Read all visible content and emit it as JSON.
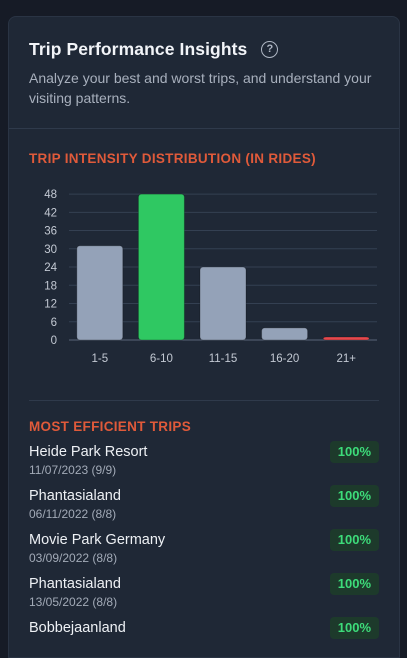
{
  "header": {
    "title": "Trip Performance Insights",
    "help_icon": "question-circle-icon",
    "subtitle": "Analyze your best and worst trips, and understand your visiting patterns."
  },
  "distribution": {
    "heading": "TRIP INTENSITY DISTRIBUTION (IN RIDES)"
  },
  "chart_data": {
    "type": "bar",
    "title": "TRIP INTENSITY DISTRIBUTION (IN RIDES)",
    "categories": [
      "1-5",
      "6-10",
      "11-15",
      "16-20",
      "21+"
    ],
    "values": [
      31,
      48,
      24,
      4,
      1
    ],
    "bar_colors": [
      "#94a2b8",
      "#2fc862",
      "#94a2b8",
      "#94a2b8",
      "#e5484d"
    ],
    "yticks": [
      0,
      6,
      12,
      18,
      24,
      30,
      36,
      42,
      48
    ],
    "ylim": [
      0,
      50
    ],
    "grid": true
  },
  "efficient": {
    "heading": "MOST EFFICIENT TRIPS",
    "trips": [
      {
        "name": "Heide Park Resort",
        "meta": "11/07/2023 (9/9)",
        "pct": "100%"
      },
      {
        "name": "Phantasialand",
        "meta": "06/11/2022 (8/8)",
        "pct": "100%"
      },
      {
        "name": "Movie Park Germany",
        "meta": "03/09/2022 (8/8)",
        "pct": "100%"
      },
      {
        "name": "Phantasialand",
        "meta": "13/05/2022 (8/8)",
        "pct": "100%"
      },
      {
        "name": "Bobbejaanland",
        "meta": "",
        "pct": "100%"
      }
    ]
  },
  "colors": {
    "accent": "#e05a3a",
    "success": "#3ddc7a",
    "card_bg": "#1f2836"
  }
}
